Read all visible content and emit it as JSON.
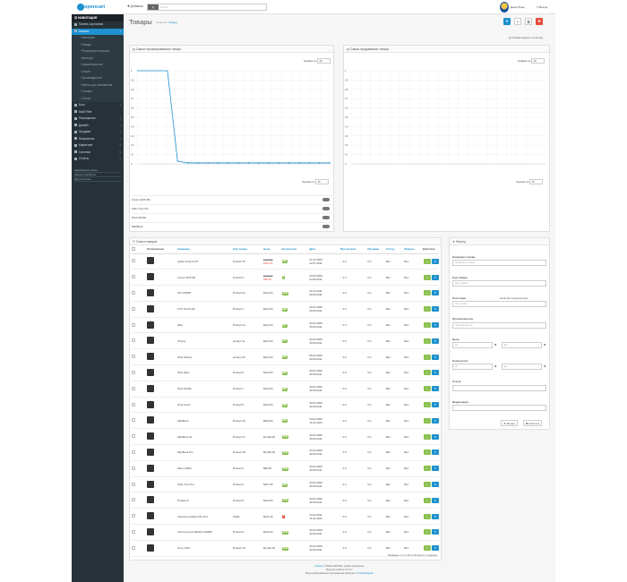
{
  "brand": {
    "logo": "opencart"
  },
  "header": {
    "add_label": "Добавить",
    "search_type": "Q",
    "search_placeholder": "Поиск",
    "user_name": "Демо Юзер",
    "logout_label": "Выход"
  },
  "sidebar": {
    "title": "НАВИГАЦИЯ",
    "items": [
      {
        "label": "Панель состояния",
        "state": "normal",
        "arrow": ""
      },
      {
        "label": "Каталог",
        "state": "active",
        "arrow": "v"
      },
      {
        "label": "Категории",
        "state": "sub",
        "arrow": ""
      },
      {
        "label": "Товары",
        "state": "sub",
        "arrow": ""
      },
      {
        "label": "Регулярные платежи",
        "state": "sub",
        "arrow": ""
      },
      {
        "label": "Фильтры",
        "state": "sub",
        "arrow": ""
      },
      {
        "label": "Характеристики",
        "state": "sub",
        "arrow": ">"
      },
      {
        "label": "Опции",
        "state": "sub",
        "arrow": ""
      },
      {
        "label": "Производители",
        "state": "sub",
        "arrow": ""
      },
      {
        "label": "Файлы для скачивания",
        "state": "sub",
        "arrow": ""
      },
      {
        "label": "Отзывы",
        "state": "sub",
        "arrow": ""
      },
      {
        "label": "Статьи",
        "state": "sub",
        "arrow": ""
      },
      {
        "label": "Блог",
        "state": "normal",
        "arrow": ">"
      },
      {
        "label": "Multi Filter",
        "state": "normal",
        "arrow": ""
      },
      {
        "label": "Расширения",
        "state": "normal",
        "arrow": ">"
      },
      {
        "label": "Дизайн",
        "state": "normal",
        "arrow": ">"
      },
      {
        "label": "Продажи",
        "state": "normal",
        "arrow": ">"
      },
      {
        "label": "Покупатели",
        "state": "normal",
        "arrow": ">"
      },
      {
        "label": "Маркетинг",
        "state": "normal",
        "arrow": ">"
      },
      {
        "label": "Система",
        "state": "normal",
        "arrow": ">"
      },
      {
        "label": "Отчеты",
        "state": "normal",
        "arrow": ">"
      }
    ],
    "stats": [
      "Завершенные заказы",
      "Заказы в обработке",
      "Другие статусы"
    ]
  },
  "page": {
    "title": "Товары",
    "breadcrumb_home": "Главная",
    "breadcrumb_current": "Товары",
    "toolbar_note": "Показать/скрыть статистику"
  },
  "chart_left": {
    "title": "Самые просматриваемые товары",
    "graph_label": "График по",
    "graph_value": "10",
    "show_label": "Оценки по",
    "show_value": "10",
    "legend": [
      "Canon EOS 5D",
      "Palm Treo Pro",
      "iPod Shuffle",
      "MacBook"
    ]
  },
  "chart_right": {
    "title": "Самые продаваемые товары",
    "graph_label": "График по",
    "graph_value": "10",
    "show_label": "Оценки по",
    "show_value": "10"
  },
  "chart_data": [
    {
      "type": "line",
      "title": "Самые просматриваемые товары",
      "x": [
        1,
        2,
        3,
        4,
        5,
        6,
        7,
        8,
        9,
        10,
        11,
        12,
        13,
        14,
        15,
        16,
        17,
        18,
        19,
        20
      ],
      "series": [
        {
          "values": [
            1,
            1,
            1,
            1,
            0.03,
            0.01,
            0.01,
            0.01,
            0.01,
            0.01,
            0.01,
            0.01,
            0.01,
            0.01,
            0.01,
            0.01,
            0.01,
            0.01,
            0.01,
            0.01
          ]
        }
      ],
      "ylim": [
        0,
        1
      ],
      "yticks": [
        "1",
        "0.9",
        "0.8",
        "0.7",
        "0.6",
        "0.5",
        "0.4",
        "0.3",
        "0.2",
        "0.1",
        "0"
      ],
      "color": "#1e91cf"
    },
    {
      "type": "line",
      "title": "Самые продаваемые товары",
      "x": [],
      "series": [],
      "ylim": [
        0,
        1
      ],
      "yticks": [
        "1",
        "0.9",
        "0.8",
        "0.7",
        "0.6",
        "0.5",
        "0.4",
        "0.3",
        "0.2",
        "0.1",
        "0"
      ]
    }
  ],
  "products": {
    "title": "Список товаров",
    "headers": [
      "Изображение",
      "Название",
      "Код товара",
      "Цена",
      "Количество",
      "Дата",
      "Просмотров",
      "Продажи",
      "Статус",
      "Модуль",
      "Действия"
    ],
    "rows": [
      {
        "name": "Apple Cinema 30\"",
        "model": "Product 15",
        "price": "$122.00",
        "special": "$110.00",
        "qty": "990",
        "qc": "#8cc152",
        "d1": "21.07.2009",
        "d2": "22.07.2011",
        "views": "3.0",
        "sales": "0.0",
        "status": "Вкл",
        "module": "Вкл"
      },
      {
        "name": "Canon EOS 5D",
        "model": "Product 3",
        "price": "$122.00",
        "special": "$98.00",
        "qty": "7",
        "qc": "#8cc152",
        "d1": "03.02.2009",
        "d2": "04.09.2011",
        "views": "2.1",
        "sales": "0.0",
        "status": "Вкл",
        "module": "Вкл"
      },
      {
        "name": "HP LP3065",
        "model": "Product 21",
        "price": "$122.00",
        "special": "",
        "qty": "1000",
        "qc": "#8cc152",
        "d1": "21.02.2011",
        "d2": "28.09.2011",
        "views": "3.0",
        "sales": "0.0",
        "status": "Вкл",
        "module": "Вкл"
      },
      {
        "name": "HTC Touch HD",
        "model": "Product 1",
        "price": "$122.00",
        "special": "",
        "qty": "939",
        "qc": "#8cc152",
        "d1": "03.02.2009",
        "d2": "29.09.2011",
        "views": "3.0",
        "sales": "0.0",
        "status": "Вкл",
        "module": "Вкл"
      },
      {
        "name": "iMac",
        "model": "Product 14",
        "price": "$122.00",
        "special": "",
        "qty": "977",
        "qc": "#8cc152",
        "d1": "03.02.2009",
        "d2": "30.09.2011",
        "views": "2.4",
        "sales": "0.0",
        "status": "Вкл",
        "module": "Вкл"
      },
      {
        "name": "iPhone",
        "model": "product 11",
        "price": "$122.00",
        "special": "",
        "qty": "970",
        "qc": "#8cc152",
        "d1": "03.02.2009",
        "d2": "30.09.2011",
        "views": "3.0",
        "sales": "0.0",
        "status": "Вкл",
        "module": "Вкл"
      },
      {
        "name": "iPod Classic",
        "model": "product 20",
        "price": "$122.00",
        "special": "",
        "qty": "995",
        "qc": "#8cc152",
        "d1": "08.02.2009",
        "d2": "30.09.2011",
        "views": "3.0",
        "sales": "0.0",
        "status": "Вкл",
        "module": "Вкл"
      },
      {
        "name": "iPod Nano",
        "model": "Product 9",
        "price": "$122.00",
        "special": "",
        "qty": "994",
        "qc": "#8cc152",
        "d1": "03.02.2009",
        "d2": "30.09.2011",
        "views": "3.0",
        "sales": "0.0",
        "status": "Вкл",
        "module": "Вкл"
      },
      {
        "name": "iPod Shuffle",
        "model": "Product 7",
        "price": "$122.00",
        "special": "",
        "qty": "995",
        "qc": "#8cc152",
        "d1": "03.02.2009",
        "d2": "30.09.2011",
        "views": "3.0",
        "sales": "0.0",
        "status": "Вкл",
        "module": "Вкл"
      },
      {
        "name": "iPod Touch",
        "model": "Product 5",
        "price": "$122.00",
        "special": "",
        "qty": "999",
        "qc": "#8cc152",
        "d1": "03.02.2009",
        "d2": "30.09.2011",
        "views": "3.0",
        "sales": "0.0",
        "status": "Вкл",
        "module": "Вкл"
      },
      {
        "name": "MacBook",
        "model": "Product 16",
        "price": "$602.00",
        "special": "",
        "qty": "929",
        "qc": "#8cc152",
        "d1": "03.02.2009",
        "d2": "10.11.2024",
        "views": "3.0",
        "sales": "0.0",
        "status": "Вкл",
        "module": "Вкл"
      },
      {
        "name": "MacBook Air",
        "model": "Product 17",
        "price": "$1,202.00",
        "special": "",
        "qty": "1000",
        "qc": "#8cc152",
        "d1": "03.02.2009",
        "d2": "30.09.2011",
        "views": "3.0",
        "sales": "0.0",
        "status": "Вкл",
        "module": "Вкл"
      },
      {
        "name": "MacBook Pro",
        "model": "Product 18",
        "price": "$2,000.00",
        "special": "",
        "qty": "1000",
        "qc": "#8cc152",
        "d1": "03.02.2009",
        "d2": "30.09.2011",
        "views": "3.0",
        "sales": "0.0",
        "status": "Вкл",
        "module": "Вкл"
      },
      {
        "name": "Nikon D300",
        "model": "Product 4",
        "price": "$98.00",
        "special": "",
        "qty": "1000",
        "qc": "#8cc152",
        "d1": "03.02.2009",
        "d2": "30.09.2011",
        "views": "3.0",
        "sales": "0.0",
        "status": "Вкл",
        "module": "Вкл"
      },
      {
        "name": "Palm Treo Pro",
        "model": "Product 2",
        "price": "$337.99",
        "special": "",
        "qty": "999",
        "qc": "#8cc152",
        "d1": "03.02.2009",
        "d2": "30.09.2011",
        "views": "2.1",
        "sales": "0.0",
        "status": "Вкл",
        "module": "Вкл"
      },
      {
        "name": "Product 8",
        "model": "Product 8",
        "price": "$122.00",
        "special": "",
        "qty": "1000",
        "qc": "#8cc152",
        "d1": "03.02.2009",
        "d2": "30.09.2011",
        "views": "3.0",
        "sales": "0.0",
        "status": "Вкл",
        "module": "Вкл"
      },
      {
        "name": "Samsung Galaxy Tab 10.1",
        "model": "SAM1",
        "price": "$241.99",
        "special": "",
        "qty": "0",
        "qc": "#e74c3c",
        "d1": "03.02.2011",
        "d2": "10.11.2024",
        "views": "3.0",
        "sales": "0.0",
        "status": "Вкл",
        "module": "Вкл"
      },
      {
        "name": "Samsung SyncMaster 941BW",
        "model": "Product 6",
        "price": "$242.00",
        "special": "",
        "qty": "1000",
        "qc": "#8cc152",
        "d1": "03.02.2009",
        "d2": "30.09.2011",
        "views": "3.0",
        "sales": "0.0",
        "status": "Вкл",
        "module": "Вкл"
      },
      {
        "name": "Sony VAIO",
        "model": "Product 19",
        "price": "$1,202.00",
        "special": "",
        "qty": "1000",
        "qc": "#8cc152",
        "d1": "03.02.2009",
        "d2": "30.09.2011",
        "views": "3.0",
        "sales": "0.0",
        "status": "Вкл",
        "module": "Вкл"
      }
    ],
    "pagination": "Показано с 1 по 19 из 19 (всего 1 страниц)"
  },
  "filter": {
    "title": "Фильтр",
    "name_label": "Название товара",
    "name_placeholder": "Название товара",
    "model_label": "Код товара",
    "model_placeholder": "Код товара",
    "category_label": "Категория",
    "category_sub_label": "включая подкатегории",
    "category_placeholder": "Категория",
    "manufacturer_label": "Производитель",
    "manufacturer_placeholder": "Производитель",
    "price_label": "Цена",
    "price_from": "От",
    "price_to": "До",
    "qty_label": "Количество",
    "qty_from": "От",
    "qty_to": "До",
    "status_label": "Статус",
    "noindex_label": "Индексация",
    "filter_button": "Фильтр",
    "reset_button": "Очистить"
  },
  "footer": {
    "line1_link": "ocStore",
    "line1": "© 2009-2025 Все права защищены.",
    "line2": "Версия ocStore 3.0.3.7",
    "line3": "Масштабированные приложения работают",
    "line3_link": "TurboNavigator"
  },
  "colors": {
    "accent": "#1e91cf",
    "success": "#8cc152",
    "danger": "#e74c3c",
    "sidebar": "#263238"
  }
}
